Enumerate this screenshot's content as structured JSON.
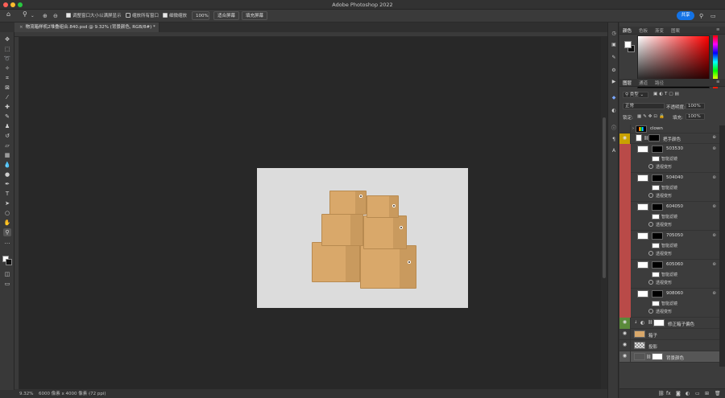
{
  "window": {
    "title": "Adobe Photoshop 2022"
  },
  "options_bar": {
    "resize_windows_label": "调整窗口大小以满屏显示",
    "zoom_all_windows_label": "缩放所有窗口",
    "scrubby_zoom_label": "细微缩放",
    "zoom_percent": "100%",
    "fit_screen_label": "适合屏幕",
    "fill_screen_label": "填充屏幕",
    "share_label": "共享"
  },
  "document": {
    "tab_label": "物流箱样机2堆叠组合.840.psd @ 9.32% (背景颜色, RGB/8#) *"
  },
  "status": {
    "zoom": "9.32%",
    "doc_info": "6000 像素 x 4000 像素 (72 ppi)"
  },
  "color_panel": {
    "tabs": [
      "颜色",
      "色板",
      "渐变",
      "图案"
    ],
    "fg_color": "#ffffff",
    "bg_color": "#111111"
  },
  "layers_panel": {
    "tabs": [
      "图层",
      "通道",
      "路径"
    ],
    "filter_kind": "类型",
    "blend_mode": "正常",
    "opacity_label": "不透明度:",
    "opacity_value": "100%",
    "lock_label": "锁定:",
    "fill_label": "填充:",
    "fill_value": "100%",
    "layers": [
      {
        "name": "clown",
        "kind": "group",
        "eye": "",
        "color": ""
      },
      {
        "name": "把手颜色",
        "kind": "adjust",
        "eye": "◉",
        "color": "#c9a200"
      },
      {
        "name": "503530",
        "kind": "smart",
        "eye": "",
        "color": "#b94a48",
        "filter": "智能滤镜",
        "sub": "透视变形"
      },
      {
        "name": "504040",
        "kind": "smart",
        "eye": "",
        "color": "#b94a48",
        "filter": "智能滤镜",
        "sub": "透视变形"
      },
      {
        "name": "604050",
        "kind": "smart",
        "eye": "",
        "color": "#b94a48",
        "filter": "智能滤镜",
        "sub": "透视变形"
      },
      {
        "name": "705050",
        "kind": "smart",
        "eye": "",
        "color": "#b94a48",
        "filter": "智能滤镜",
        "sub": "透视变形"
      },
      {
        "name": "605060",
        "kind": "smart",
        "eye": "",
        "color": "#b94a48",
        "filter": "智能滤镜",
        "sub": "透视变形"
      },
      {
        "name": "908060",
        "kind": "smart",
        "eye": "",
        "color": "#b94a48",
        "filter": "智能滤镜",
        "sub": "透视变形"
      },
      {
        "name": "修正箱子偏色",
        "kind": "adjust",
        "eye": "◉",
        "color": "#5a8a3a"
      },
      {
        "name": "箱子",
        "kind": "plain",
        "eye": "◉",
        "color": ""
      },
      {
        "name": "投影",
        "kind": "plain",
        "eye": "◉",
        "color": ""
      },
      {
        "name": "背景颜色",
        "kind": "plain",
        "eye": "◉",
        "color": "",
        "selected": true
      }
    ]
  },
  "colors": {
    "accent": "#1473e6",
    "red_label": "#b94a48",
    "yellow_label": "#c9a200",
    "green_label": "#5a8a3a"
  }
}
